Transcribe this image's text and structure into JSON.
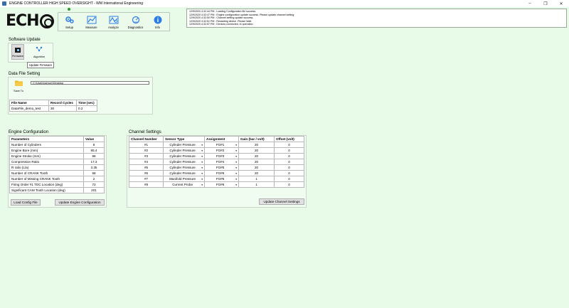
{
  "window": {
    "title": "ENGINE CONTROLLER HIGH SPEED OVERSIGHT - WM International Engineering",
    "minimize": "–",
    "maximize": "❐",
    "close": "✕"
  },
  "logo": {
    "text": "ECH"
  },
  "toolbar": [
    {
      "label": "Setup",
      "icon": "gears-icon"
    },
    {
      "label": "Measure",
      "icon": "chart-icon"
    },
    {
      "label": "Analyze",
      "icon": "analyze-icon"
    },
    {
      "label": "Diagnostics",
      "icon": "diagnostics-icon"
    },
    {
      "label": "Info",
      "icon": "info-icon"
    }
  ],
  "log": [
    "12/9/2020 4:32:44 PM : Loading Configuration file success.",
    "12/9/2020 4:32:47 PM : Engine configuration update success. Please update channel setting.",
    "12/9/2020 4:32:50 PM : Channel setting update success.",
    "12/9/2020 4:32:51 PM : Restarting device. Please Wait.",
    "12/9/2020 4:32:57 PM : Devices connected, in operation."
  ],
  "software_update": {
    "title": "Software Update",
    "firmware_label": "Firmware",
    "algorithm_label": "Algorithm",
    "tooltip": "Update Firmware"
  },
  "data_file": {
    "title": "Data File Setting",
    "save_to_label": "Save To",
    "path": "C:\\Users\\simon\\Desktop",
    "headers": [
      "File Name",
      "Record Cycles",
      "Time (sec)"
    ],
    "row": [
      "DataFile_demo_test",
      "30",
      "0.2"
    ]
  },
  "engine_config": {
    "title": "Engine Configuration",
    "headers": [
      "Parameters",
      "Value"
    ],
    "rows": [
      [
        "Number of Cylinders",
        "6"
      ],
      [
        "Engine Bore (mm)",
        "85.4"
      ],
      [
        "Engine Stroke (mm)",
        "96"
      ],
      [
        "Compression Ratio",
        "17.3"
      ],
      [
        "R ratio (L/a)",
        "3.35"
      ],
      [
        "Number of CRANK Tooth",
        "58"
      ],
      [
        "Number of Missing CRANK Tooth",
        "2"
      ],
      [
        "Firing Order #1 TDC Location (deg)",
        "72"
      ],
      [
        "Significant CAM Tooth Location (deg)",
        "201"
      ]
    ],
    "load_button": "Load Config File",
    "update_button": "Update Engine Configuration"
  },
  "channel_settings": {
    "title": "Channel Settings",
    "headers": [
      "Channel Number",
      "Sensor Type",
      "Assignment",
      "Gain (bar / volt)",
      "Offset (volt)"
    ],
    "rows": [
      [
        "#1",
        "Cylinder Pressure",
        "FO#1",
        "20",
        "0"
      ],
      [
        "#2",
        "Cylinder Pressure",
        "FO#2",
        "20",
        "0"
      ],
      [
        "#3",
        "Cylinder Pressure",
        "FO#3",
        "20",
        "0"
      ],
      [
        "#4",
        "Cylinder Pressure",
        "FO#4",
        "20",
        "0"
      ],
      [
        "#5",
        "Cylinder Pressure",
        "FO#5",
        "20",
        "0"
      ],
      [
        "#6",
        "Cylinder Pressure",
        "FO#6",
        "20",
        "0"
      ],
      [
        "#7",
        "Manifold Pressure",
        "FO#5",
        "1",
        "0"
      ],
      [
        "#8",
        "Current Probe",
        "FO#6",
        "1",
        "0"
      ]
    ],
    "update_button": "Update Channel Settings",
    "dropdown_arrow": "▾"
  },
  "colors": {
    "background": "#e8fbe8",
    "accent_blue": "#2b7de9"
  }
}
